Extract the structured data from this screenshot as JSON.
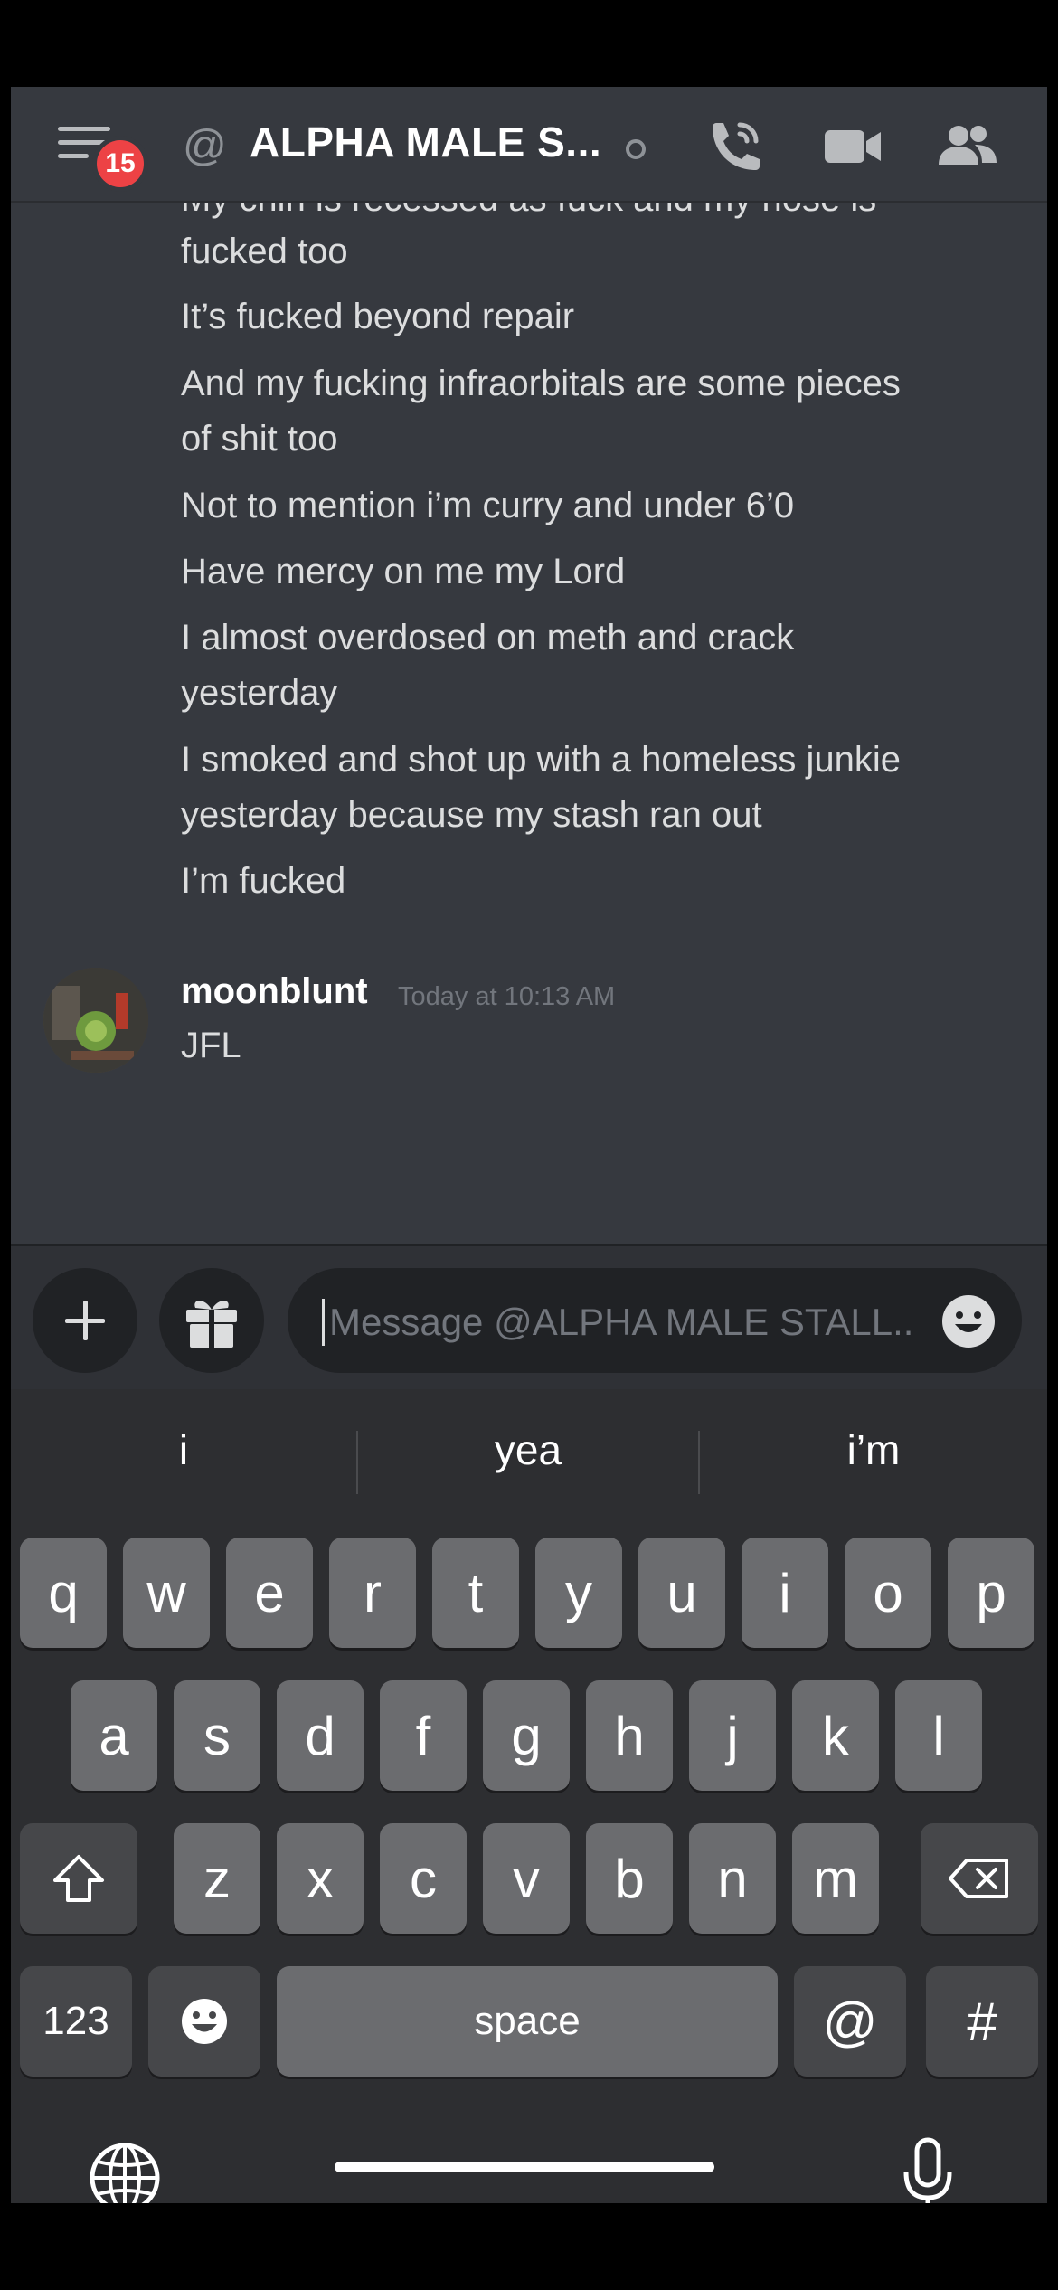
{
  "header": {
    "unread_badge": "15",
    "dm_title": "ALPHA MALE S...",
    "icons": [
      "hamburger-menu-icon",
      "at-icon",
      "call-icon",
      "video-icon",
      "members-icon"
    ]
  },
  "messages": {
    "group1_lines": [
      "My chin is recessed as fuck and my nose is",
      "fucked too",
      "It’s fucked beyond repair",
      "And my fucking infraorbitals are some pieces",
      "of shit too",
      "Not to mention i’m curry and under 6’0",
      "Have mercy on me my Lord",
      "I almost overdosed on meth and crack",
      "yesterday",
      "I smoked and shot up with a homeless junkie",
      "yesterday because my stash ran out",
      "I’m fucked"
    ],
    "last": {
      "username": "moonblunt",
      "timestamp": "Today at 10:13 AM",
      "text": "JFL"
    }
  },
  "composer": {
    "placeholder": "Message @ALPHA MALE STALL.."
  },
  "keyboard": {
    "suggestions": [
      "i",
      "yea",
      "i’m"
    ],
    "row1": [
      "q",
      "w",
      "e",
      "r",
      "t",
      "y",
      "u",
      "i",
      "o",
      "p"
    ],
    "row2": [
      "a",
      "s",
      "d",
      "f",
      "g",
      "h",
      "j",
      "k",
      "l"
    ],
    "row3": [
      "z",
      "x",
      "c",
      "v",
      "b",
      "n",
      "m"
    ],
    "numbers_label": "123",
    "space_label": "space",
    "at_label": "@",
    "hash_label": "#"
  },
  "colors": {
    "background": "#36393f",
    "badge": "#ed4245",
    "text": "#dcddde",
    "muted": "#72767d"
  }
}
